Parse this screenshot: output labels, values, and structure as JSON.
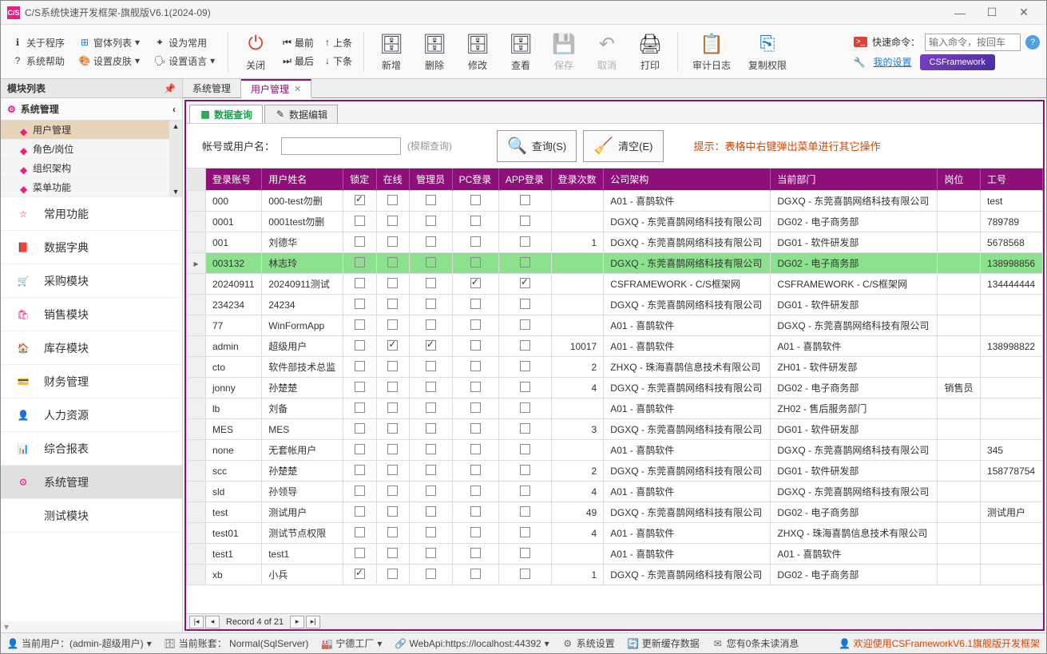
{
  "title": "C/S系统快速开发框架-旗舰版V6.1(2024-09)",
  "ribbon": {
    "about": "关于程序",
    "winlist": "窗体列表",
    "setcommon": "设为常用",
    "syshelp": "系统帮助",
    "skin": "设置皮肤",
    "lang": "设置语言",
    "close": "关闭",
    "first": "最前",
    "prev": "上条",
    "last": "最后",
    "next": "下条",
    "add": "新增",
    "delete": "删除",
    "edit": "修改",
    "view": "查看",
    "save": "保存",
    "cancel": "取消",
    "print": "打印",
    "audit": "审计日志",
    "copyauth": "复制权限",
    "quickcmd": "快速命令：",
    "quickph": "输入命令，按回车",
    "mysettings": "我的设置",
    "csf": "CSFramework"
  },
  "sidebar": {
    "head": "模块列表",
    "syshead": "系统管理",
    "tree": [
      "用户管理",
      "角色/岗位",
      "组织架构",
      "菜单功能"
    ],
    "modules": [
      "常用功能",
      "数据字典",
      "采购模块",
      "销售模块",
      "库存模块",
      "财务管理",
      "人力资源",
      "综合报表",
      "系统管理",
      "测试模块"
    ]
  },
  "doctabs": {
    "t0": "系统管理",
    "t1": "用户管理"
  },
  "subtabs": {
    "t0": "数据查询",
    "t1": "数据编辑"
  },
  "search": {
    "label": "帐号或用户名：",
    "hint": "(模糊查询)",
    "btnSearch": "查询(S)",
    "btnClear": "清空(E)",
    "tip": "提示：表格中右键弹出菜单进行其它操作"
  },
  "cols": [
    "登录账号",
    "用户姓名",
    "锁定",
    "在线",
    "管理员",
    "PC登录",
    "APP登录",
    "登录次数",
    "公司架构",
    "当前部门",
    "岗位",
    "工号"
  ],
  "rows": [
    {
      "acc": "000",
      "name": "000-test勿删",
      "lock": true,
      "online": false,
      "admin": false,
      "pc": false,
      "app": false,
      "cnt": "",
      "org": "A01 - 喜鹊软件",
      "dept": "DGXQ - 东莞喜鹊网络科技有限公司",
      "pos": "",
      "no": "test"
    },
    {
      "acc": "0001",
      "name": "0001test勿删",
      "lock": false,
      "online": false,
      "admin": false,
      "pc": false,
      "app": false,
      "cnt": "",
      "org": "DGXQ - 东莞喜鹊网络科技有限公司",
      "dept": "DG02 - 电子商务部",
      "pos": "",
      "no": "789789"
    },
    {
      "acc": "001",
      "name": "刘德华",
      "lock": false,
      "online": false,
      "admin": false,
      "pc": false,
      "app": false,
      "cnt": "1",
      "org": "DGXQ - 东莞喜鹊网络科技有限公司",
      "dept": "DG01 - 软件研发部",
      "pos": "",
      "no": "5678568"
    },
    {
      "acc": "003132",
      "name": "林志玲",
      "lock": false,
      "online": false,
      "admin": false,
      "pc": false,
      "app": false,
      "cnt": "",
      "org": "DGXQ - 东莞喜鹊网络科技有限公司",
      "dept": "DG02 - 电子商务部",
      "pos": "",
      "no": "138998856",
      "sel": true
    },
    {
      "acc": "20240911",
      "name": "20240911测试",
      "lock": false,
      "online": false,
      "admin": false,
      "pc": true,
      "app": true,
      "cnt": "",
      "org": "CSFRAMEWORK - C/S框架网",
      "dept": "CSFRAMEWORK - C/S框架网",
      "pos": "",
      "no": "134444444"
    },
    {
      "acc": "234234",
      "name": "24234",
      "lock": false,
      "online": false,
      "admin": false,
      "pc": false,
      "app": false,
      "cnt": "",
      "org": "DGXQ - 东莞喜鹊网络科技有限公司",
      "dept": "DG01 - 软件研发部",
      "pos": "",
      "no": ""
    },
    {
      "acc": "77",
      "name": "WinFormApp",
      "lock": false,
      "online": false,
      "admin": false,
      "pc": false,
      "app": false,
      "cnt": "",
      "org": "A01 - 喜鹊软件",
      "dept": "DGXQ - 东莞喜鹊网络科技有限公司",
      "pos": "",
      "no": ""
    },
    {
      "acc": "admin",
      "name": "超级用户",
      "lock": false,
      "online": true,
      "admin": true,
      "pc": false,
      "app": false,
      "cnt": "10017",
      "org": "A01 - 喜鹊软件",
      "dept": "A01 - 喜鹊软件",
      "pos": "",
      "no": "138998822"
    },
    {
      "acc": "cto",
      "name": "软件部技术总监",
      "lock": false,
      "online": false,
      "admin": false,
      "pc": false,
      "app": false,
      "cnt": "2",
      "org": "ZHXQ - 珠海喜鹊信息技术有限公司",
      "dept": "ZH01 - 软件研发部",
      "pos": "",
      "no": ""
    },
    {
      "acc": "jonny",
      "name": "孙楚楚",
      "lock": false,
      "online": false,
      "admin": false,
      "pc": false,
      "app": false,
      "cnt": "4",
      "org": "DGXQ - 东莞喜鹊网络科技有限公司",
      "dept": "DG02 - 电子商务部",
      "pos": "销售员",
      "no": ""
    },
    {
      "acc": "lb",
      "name": "刘备",
      "lock": false,
      "online": false,
      "admin": false,
      "pc": false,
      "app": false,
      "cnt": "",
      "org": "A01 - 喜鹊软件",
      "dept": "ZH02 - 售后服务部门",
      "pos": "",
      "no": ""
    },
    {
      "acc": "MES",
      "name": "MES",
      "lock": false,
      "online": false,
      "admin": false,
      "pc": false,
      "app": false,
      "cnt": "3",
      "org": "DGXQ - 东莞喜鹊网络科技有限公司",
      "dept": "DG01 - 软件研发部",
      "pos": "",
      "no": ""
    },
    {
      "acc": "none",
      "name": "无套帐用户",
      "lock": false,
      "online": false,
      "admin": false,
      "pc": false,
      "app": false,
      "cnt": "",
      "org": "A01 - 喜鹊软件",
      "dept": "DGXQ - 东莞喜鹊网络科技有限公司",
      "pos": "",
      "no": "345"
    },
    {
      "acc": "scc",
      "name": "孙楚楚",
      "lock": false,
      "online": false,
      "admin": false,
      "pc": false,
      "app": false,
      "cnt": "2",
      "org": "DGXQ - 东莞喜鹊网络科技有限公司",
      "dept": "DG01 - 软件研发部",
      "pos": "",
      "no": "158778754"
    },
    {
      "acc": "sld",
      "name": "孙领导",
      "lock": false,
      "online": false,
      "admin": false,
      "pc": false,
      "app": false,
      "cnt": "4",
      "org": "A01 - 喜鹊软件",
      "dept": "DGXQ - 东莞喜鹊网络科技有限公司",
      "pos": "",
      "no": ""
    },
    {
      "acc": "test",
      "name": "测试用户",
      "lock": false,
      "online": false,
      "admin": false,
      "pc": false,
      "app": false,
      "cnt": "49",
      "org": "DGXQ - 东莞喜鹊网络科技有限公司",
      "dept": "DG02 - 电子商务部",
      "pos": "",
      "no": "测试用户"
    },
    {
      "acc": "test01",
      "name": "测试节点权限",
      "lock": false,
      "online": false,
      "admin": false,
      "pc": false,
      "app": false,
      "cnt": "4",
      "org": "A01 - 喜鹊软件",
      "dept": "ZHXQ - 珠海喜鹊信息技术有限公司",
      "pos": "",
      "no": ""
    },
    {
      "acc": "test1",
      "name": "test1",
      "lock": false,
      "online": false,
      "admin": false,
      "pc": false,
      "app": false,
      "cnt": "",
      "org": "A01 - 喜鹊软件",
      "dept": "A01 - 喜鹊软件",
      "pos": "",
      "no": ""
    },
    {
      "acc": "xb",
      "name": "小兵",
      "lock": true,
      "online": false,
      "admin": false,
      "pc": false,
      "app": false,
      "cnt": "1",
      "org": "DGXQ - 东莞喜鹊网络科技有限公司",
      "dept": "DG02 - 电子商务部",
      "pos": "",
      "no": ""
    }
  ],
  "navrec": "Record 4 of 21",
  "status": {
    "user": "当前用户：(admin-超级用户)",
    "acct": "当前账套： Normal(SqlServer)",
    "factory": "宁德工厂",
    "webapi": "WebApi:https://localhost:44392",
    "syssetting": "系统设置",
    "refresh": "更新缓存数据",
    "msg": "您有0条未读消息",
    "welcome": "欢迎使用CSFrameworkV6.1旗舰版开发框架"
  }
}
